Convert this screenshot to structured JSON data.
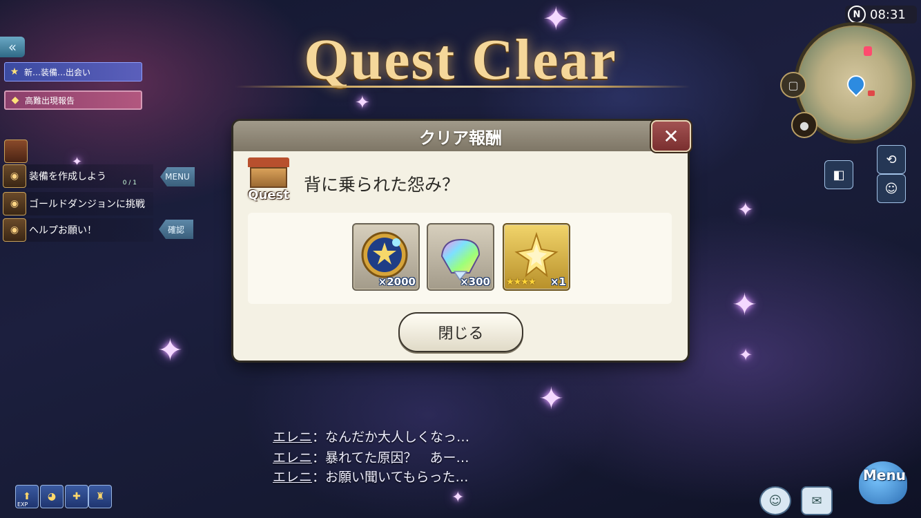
{
  "hud": {
    "time": "08:31",
    "compass": "N",
    "back_icon": "«"
  },
  "title": "Quest Clear",
  "left_panel": {
    "banners": [
      {
        "label": "新…装備…出会い"
      },
      {
        "label": "高難出現報告"
      }
    ],
    "quests": [
      {
        "label": "装備を作成しよう",
        "progress": "0 / 1",
        "tag": "MENU"
      },
      {
        "label": "ゴールドダンジョンに挑戦",
        "progress": "",
        "tag": ""
      },
      {
        "label": "ヘルプお願い！",
        "progress": "",
        "tag": "確認"
      }
    ]
  },
  "modal": {
    "header": "クリア報酬",
    "close_icon": "✕",
    "quest_badge_label": "Quest",
    "quest_name": "背に乗られた怨み？",
    "rewards": [
      {
        "icon": "medal-icon",
        "quantity": "×2000"
      },
      {
        "icon": "crystal-icon",
        "quantity": "×300"
      },
      {
        "icon": "star-icon",
        "rarity": "★★★★",
        "quantity": "×1"
      }
    ],
    "close_button": "閉じる"
  },
  "dialogue": [
    {
      "speaker": "エレニ",
      "text": "：なんだか大人しくなっ…"
    },
    {
      "speaker": "エレニ",
      "text": "：暴れてた原因？　あー…"
    },
    {
      "speaker": "エレニ",
      "text": "：お願い聞いてもらった…"
    }
  ],
  "bottom_bar": {
    "exp_label": "EXP",
    "menu_label": "Menu"
  },
  "colors": {
    "title_gold": "#f5d79a",
    "modal_bg": "#f4f1e4",
    "header_bg": "#8f887a",
    "close_red": "#8f3c3c"
  }
}
